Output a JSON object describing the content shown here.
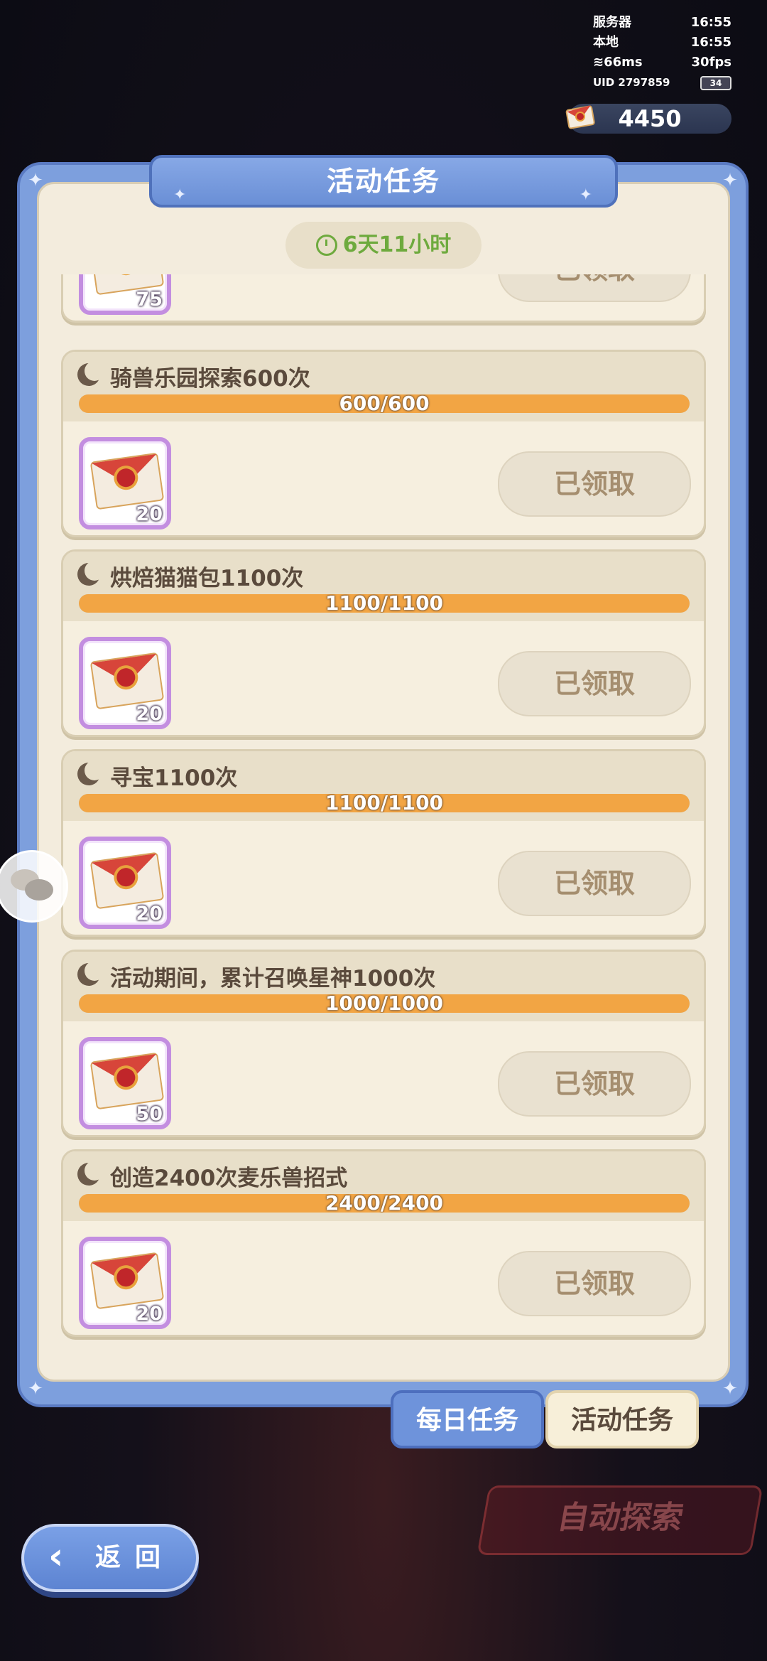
{
  "status": {
    "server_label": "服务器",
    "server_time": "16:55",
    "local_label": "本地",
    "local_time": "16:55",
    "ping": "66ms",
    "fps": "30fps",
    "uid": "UID 2797859",
    "battery": "34"
  },
  "currency": {
    "amount": "4450",
    "icon": "red-envelope-icon"
  },
  "panel": {
    "title": "活动任务",
    "timer": "6天11小时"
  },
  "tasks": [
    {
      "name": "",
      "progress": "",
      "ratio": 1,
      "reward_count": "75",
      "claim_label": "已领取"
    },
    {
      "name": "骑兽乐园探索600次",
      "progress": "600/600",
      "ratio": 1,
      "reward_count": "20",
      "claim_label": "已领取"
    },
    {
      "name": "烘焙猫猫包1100次",
      "progress": "1100/1100",
      "ratio": 1,
      "reward_count": "20",
      "claim_label": "已领取"
    },
    {
      "name": "寻宝1100次",
      "progress": "1100/1100",
      "ratio": 1,
      "reward_count": "20",
      "claim_label": "已领取"
    },
    {
      "name": "活动期间，累计召唤星神1000次",
      "progress": "1000/1000",
      "ratio": 1,
      "reward_count": "50",
      "claim_label": "已领取"
    },
    {
      "name": "创造2400次麦乐兽招式",
      "progress": "2400/2400",
      "ratio": 1,
      "reward_count": "20",
      "claim_label": "已领取"
    }
  ],
  "tabs": {
    "daily": "每日任务",
    "event": "活动任务"
  },
  "auto_explore": "自动探索",
  "back": "返回",
  "chat_icon": "chat-bubbles-icon"
}
